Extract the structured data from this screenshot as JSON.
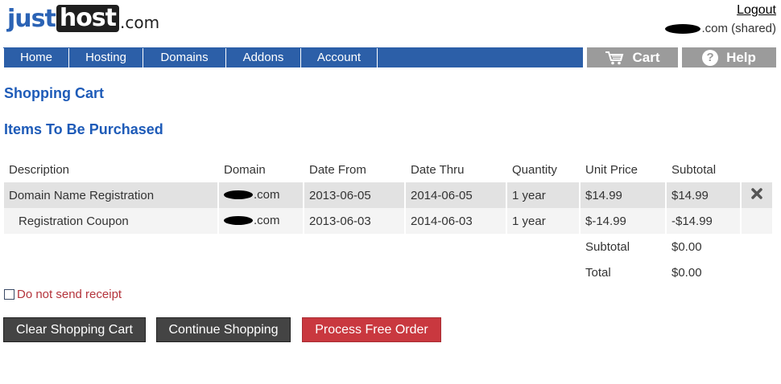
{
  "header": {
    "logo": {
      "just": "just",
      "host": "host",
      "com": ".com"
    },
    "logout_label": "Logout",
    "account_domain_suffix": ".com (shared)"
  },
  "nav": {
    "items": [
      {
        "label": "Home"
      },
      {
        "label": "Hosting"
      },
      {
        "label": "Domains"
      },
      {
        "label": "Addons"
      },
      {
        "label": "Account"
      }
    ],
    "cart_label": "Cart",
    "help_label": "Help",
    "cart_icon": "shopping-cart-icon",
    "help_icon": "question-circle-icon",
    "bar_color": "#2c5fa8",
    "util_color": "#9b9b9b"
  },
  "page_title": "Shopping Cart",
  "section_title": "Items To Be Purchased",
  "table": {
    "headers": [
      "Description",
      "Domain",
      "Date From",
      "Date Thru",
      "Quantity",
      "Unit Price",
      "Subtotal"
    ],
    "rows": [
      {
        "description": "Domain Name Registration",
        "domain_suffix": ".com",
        "date_from": "2013-06-05",
        "date_thru": "2014-06-05",
        "quantity": "1 year",
        "unit_price": "$14.99",
        "subtotal": "$14.99"
      },
      {
        "description": "Registration Coupon",
        "domain_suffix": ".com",
        "date_from": "2013-06-03",
        "date_thru": "2014-06-03",
        "quantity": "1 year",
        "unit_price": "$-14.99",
        "subtotal": "-$14.99"
      }
    ],
    "subtotal_label": "Subtotal",
    "subtotal_value": "$0.00",
    "total_label": "Total",
    "total_value": "$0.00"
  },
  "receipt_label": "Do not send receipt",
  "buttons": {
    "clear": "Clear Shopping Cart",
    "continue": "Continue Shopping",
    "process": "Process Free Order"
  },
  "colors": {
    "heading": "#1e5bb8",
    "receipt_text": "#b4333b",
    "process_button": "#c9383f",
    "dark_button": "#444444"
  }
}
